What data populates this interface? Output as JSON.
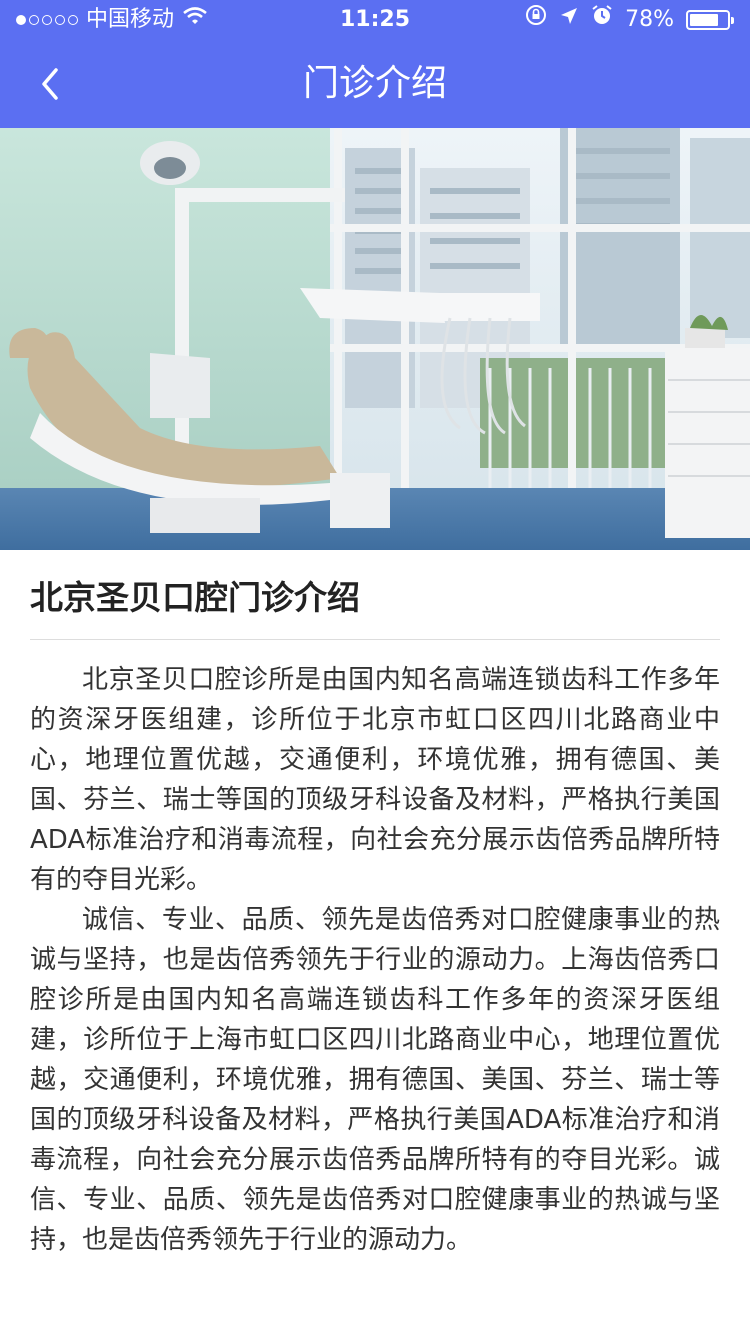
{
  "status_bar": {
    "carrier": "中国移动",
    "time": "11:25",
    "battery_percent": "78%",
    "battery_level": 0.78
  },
  "nav": {
    "title": "门诊介绍"
  },
  "article": {
    "title": "北京圣贝口腔门诊介绍",
    "paragraphs": [
      "北京圣贝口腔诊所是由国内知名高端连锁齿科工作多年的资深牙医组建，诊所位于北京市虹口区四川北路商业中心，地理位置优越，交通便利，环境优雅，拥有德国、美国、芬兰、瑞士等国的顶级牙科设备及材料，严格执行美国ADA标准治疗和消毒流程，向社会充分展示齿倍秀品牌所特有的夺目光彩。",
      "诚信、专业、品质、领先是齿倍秀对口腔健康事业的热诚与坚持，也是齿倍秀领先于行业的源动力。上海齿倍秀口腔诊所是由国内知名高端连锁齿科工作多年的资深牙医组建，诊所位于上海市虹口区四川北路商业中心，地理位置优越，交通便利，环境优雅，拥有德国、美国、芬兰、瑞士等国的顶级牙科设备及材料，严格执行美国ADA标准治疗和消毒流程，向社会充分展示齿倍秀品牌所特有的夺目光彩。诚信、专业、品质、领先是齿倍秀对口腔健康事业的热诚与坚持，也是齿倍秀领先于行业的源动力。"
    ]
  },
  "colors": {
    "header_bg": "#5b6ff2",
    "text": "#333333"
  }
}
